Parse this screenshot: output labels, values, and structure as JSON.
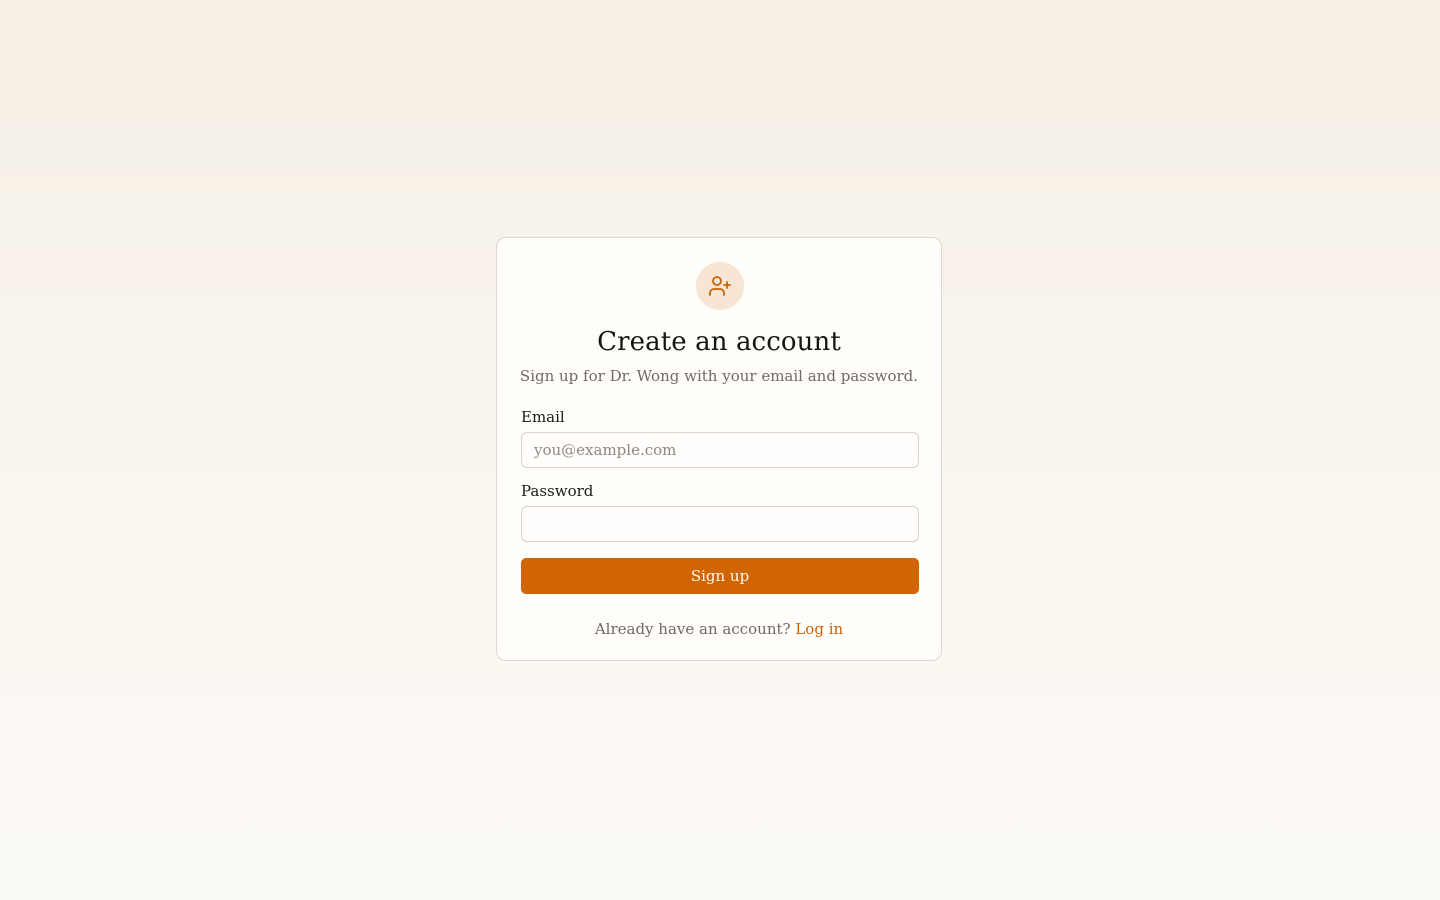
{
  "signup": {
    "title": "Create an account",
    "subtitle": "Sign up for Dr. Wong with your email and password.",
    "email_label": "Email",
    "email_placeholder": "you@example.com",
    "email_value": "",
    "password_label": "Password",
    "password_value": "",
    "submit_label": "Sign up",
    "footer_text": "Already have an account?",
    "login_link": "Log in",
    "icon": "user-plus-icon"
  },
  "colors": {
    "accent": "#d06502",
    "icon_bg": "#f8e5d3",
    "link": "#c96306"
  }
}
